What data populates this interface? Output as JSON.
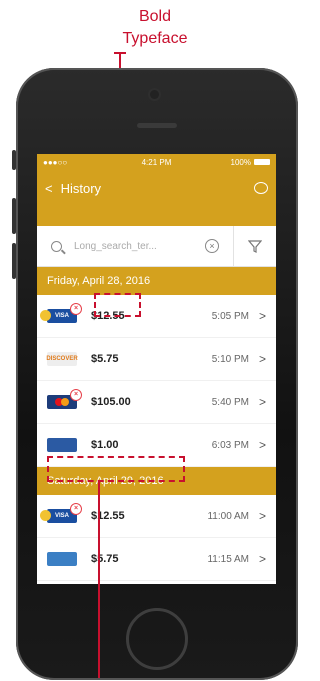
{
  "annotations": {
    "top_line1": "Bold",
    "top_line2": "Typeface"
  },
  "status_bar": {
    "carrier": "●●●○○",
    "time": "4:21 PM",
    "battery": "100%"
  },
  "nav": {
    "back": "<",
    "title": "History"
  },
  "search": {
    "placeholder": "Long_search_ter...",
    "clear": "⊗"
  },
  "sections": [
    {
      "date": "Friday, April 28, 2016",
      "transactions": [
        {
          "card": "VISA",
          "amount": "$12.55",
          "time": "5:05 PM"
        },
        {
          "card": "DISCOVER",
          "amount": "$5.75",
          "time": "5:10 PM"
        },
        {
          "card": "",
          "amount": "$105.00",
          "time": "5:40 PM"
        },
        {
          "card": "",
          "amount": "$1.00",
          "time": "6:03 PM"
        }
      ]
    },
    {
      "date": "Saturday, April 29, 2016",
      "transactions": [
        {
          "card": "VISA",
          "amount": "$12.55",
          "time": "11:00 AM"
        },
        {
          "card": "",
          "amount": "$5.75",
          "time": "11:15 AM"
        }
      ]
    }
  ],
  "chevron": ">",
  "colors": {
    "accent": "#d4a11e",
    "annotation": "#c8102e",
    "error": "#e6404a"
  }
}
